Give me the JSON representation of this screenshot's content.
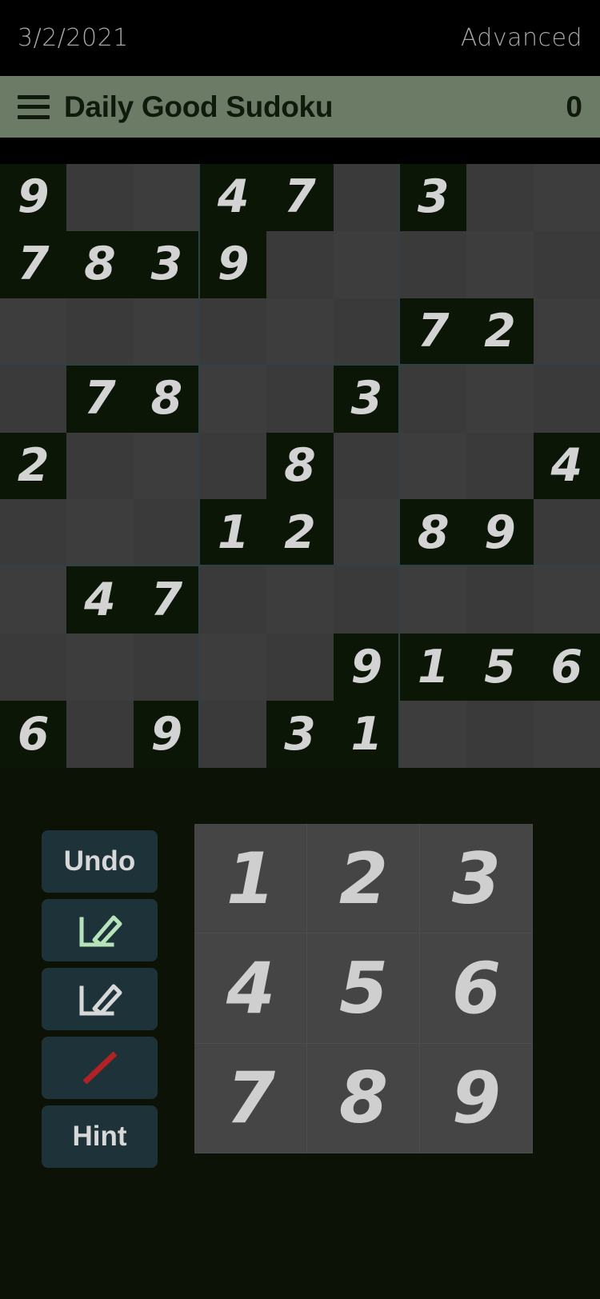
{
  "statusbar": {
    "date": "3/2/2021",
    "difficulty": "Advanced"
  },
  "appbar": {
    "menu_icon": "hamburger-menu-icon",
    "title": "Daily Good Sudoku",
    "count": "0"
  },
  "board": {
    "rows": [
      [
        "9",
        "",
        "",
        "4",
        "7",
        "",
        "3",
        "",
        ""
      ],
      [
        "7",
        "8",
        "3",
        "9",
        "",
        "",
        "",
        "",
        ""
      ],
      [
        "",
        "",
        "",
        "",
        "",
        "",
        "7",
        "2",
        ""
      ],
      [
        "",
        "7",
        "8",
        "",
        "",
        "3",
        "",
        "",
        ""
      ],
      [
        "2",
        "",
        "",
        "",
        "8",
        "",
        "",
        "",
        "4"
      ],
      [
        "",
        "",
        "",
        "1",
        "2",
        "",
        "8",
        "9",
        ""
      ],
      [
        "",
        "4",
        "7",
        "",
        "",
        "",
        "",
        "",
        ""
      ],
      [
        "",
        "",
        "",
        "",
        "",
        "9",
        "1",
        "5",
        "6"
      ],
      [
        "6",
        "",
        "9",
        "",
        "3",
        "1",
        "",
        "",
        ""
      ]
    ]
  },
  "controls": {
    "buttons": [
      {
        "name": "undo-button",
        "label": "Undo",
        "icon": ""
      },
      {
        "name": "pencil-green-button",
        "label": "",
        "icon": "pencil-edit-green-icon"
      },
      {
        "name": "pencil-white-button",
        "label": "",
        "icon": "pencil-edit-white-icon"
      },
      {
        "name": "erase-button",
        "label": "",
        "icon": "red-diagonal-line-icon"
      },
      {
        "name": "hint-button",
        "label": "Hint",
        "icon": ""
      }
    ]
  },
  "numpad": {
    "keys": [
      "1",
      "2",
      "3",
      "4",
      "5",
      "6",
      "7",
      "8",
      "9"
    ]
  },
  "colors": {
    "appbar_bg": "#6b7b65",
    "appbar_fg": "#0f1a0c",
    "board_empty": "#3d3d3d",
    "board_filled": "#0b1606",
    "board_line": "#2e4246",
    "digit": "#d3d3d3",
    "button_bg": "#1e3339",
    "numpad_bg": "#454545",
    "page_bg": "#0d1206",
    "pencil_green": "#b6e3ba",
    "pencil_white": "#d8d8d8",
    "erase_red": "#b32222"
  }
}
